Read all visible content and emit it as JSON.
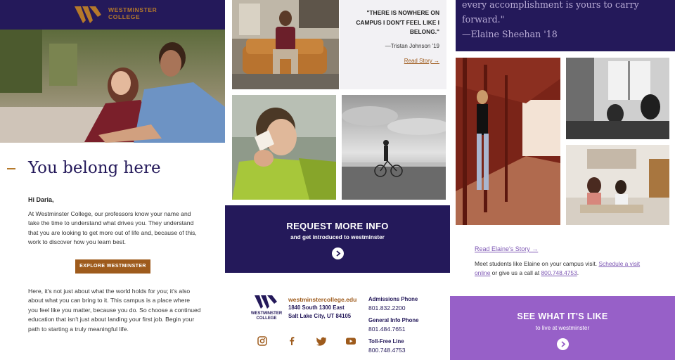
{
  "brand": {
    "logo_line1": "WESTMINSTER",
    "logo_line2": "COLLEGE",
    "color_navy": "#24195a",
    "color_bronze": "#9e5b1c",
    "color_purple": "#9760c8"
  },
  "intro": {
    "headline": "You belong here",
    "greeting": "Hi Daria,",
    "paragraph1": "At Westminster College, our professors know your name and take the time to understand what drives you. They understand that you are looking to get more out of life and, because of this, work to discover how you learn best.",
    "button_label": "EXPLORE WESTMINSTER",
    "paragraph2": "Here, it's not just about what the world holds for you; it's also about what you can bring to it. This campus is a place where you feel like you matter, because you do. So choose a continued education that isn't just about landing your first job. Begin your path to starting a truly meaningful life."
  },
  "tristan": {
    "quote": "\"THERE IS NOWHERE ON CAMPUS I DON'T FEEL LIKE I BELONG.\"",
    "author": "—Tristan Johnson '19",
    "link": "Read Story →"
  },
  "request": {
    "title": "REQUEST MORE INFO",
    "subtitle": "and get introduced to westminster"
  },
  "footer": {
    "logo_line1": "WESTMINSTER",
    "logo_line2": "COLLEGE",
    "url": "westminstercollege.edu",
    "address_line1": "1840 South 1300 East",
    "address_line2": "Salt Lake City, UT 84105",
    "phones": [
      {
        "label": "Admissions Phone",
        "number": "801.832.2200"
      },
      {
        "label": "General Info Phone",
        "number": "801.484.7651"
      },
      {
        "label": "Toll-Free Line",
        "number": "800.748.4753"
      }
    ],
    "social_icons": [
      "instagram-icon",
      "facebook-icon",
      "twitter-icon",
      "youtube-icon"
    ]
  },
  "elaine": {
    "quote_line1": "every accomplishment is yours to carry",
    "quote_line2": "forward.\"",
    "author": "—Elaine Sheehan '18",
    "link": "Read Elaine's Story →",
    "visit_prefix": "Meet students like Elaine on your campus visit. ",
    "visit_link1": "Schedule a visit online",
    "visit_middle": " or give us a call at ",
    "visit_link2": "800.748.4753",
    "visit_suffix": "."
  },
  "see": {
    "title": "SEE WHAT IT'S LIKE",
    "subtitle": "to live at westminster"
  }
}
